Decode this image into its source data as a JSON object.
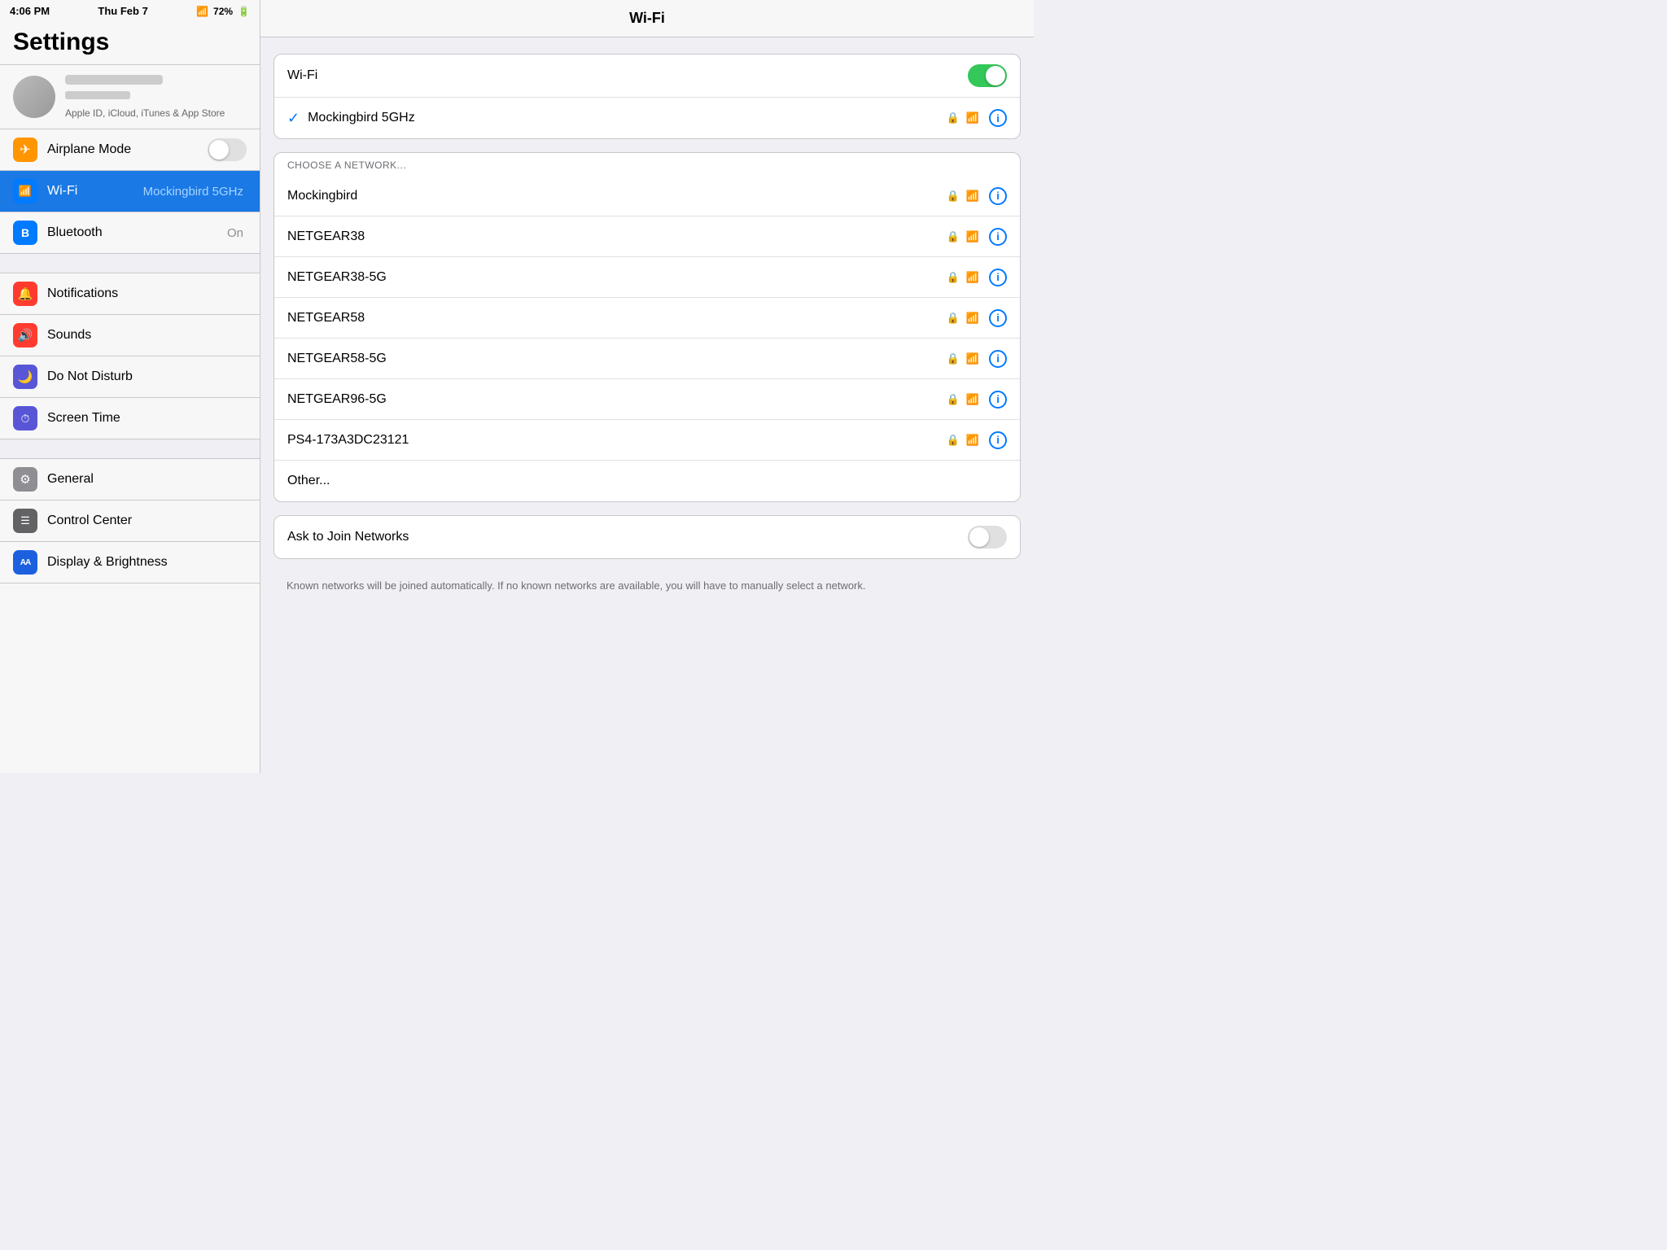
{
  "statusBar": {
    "time": "4:06 PM",
    "date": "Thu Feb 7",
    "battery": "72%"
  },
  "sidebar": {
    "title": "Settings",
    "profile": {
      "subtitle": "Apple ID, iCloud, iTunes & App Store"
    },
    "groups": [
      {
        "items": [
          {
            "id": "airplane-mode",
            "label": "Airplane Mode",
            "icon": "✈",
            "iconClass": "icon-orange",
            "hasToggle": true,
            "toggleOn": false
          },
          {
            "id": "wifi",
            "label": "Wi-Fi",
            "icon": "📶",
            "iconClass": "icon-blue",
            "value": "Mockingbird 5GHz",
            "selected": true
          },
          {
            "id": "bluetooth",
            "label": "Bluetooth",
            "icon": "B",
            "iconClass": "icon-blue-bt",
            "value": "On"
          }
        ]
      },
      {
        "items": [
          {
            "id": "notifications",
            "label": "Notifications",
            "icon": "🔔",
            "iconClass": "icon-red"
          },
          {
            "id": "sounds",
            "label": "Sounds",
            "icon": "🔊",
            "iconClass": "icon-red-sounds"
          },
          {
            "id": "do-not-disturb",
            "label": "Do Not Disturb",
            "icon": "🌙",
            "iconClass": "icon-purple"
          },
          {
            "id": "screen-time",
            "label": "Screen Time",
            "icon": "⏱",
            "iconClass": "icon-purple-screen"
          }
        ]
      },
      {
        "items": [
          {
            "id": "general",
            "label": "General",
            "icon": "⚙",
            "iconClass": "icon-gray"
          },
          {
            "id": "control-center",
            "label": "Control Center",
            "icon": "☰",
            "iconClass": "icon-dark-gray"
          },
          {
            "id": "display-brightness",
            "label": "Display & Brightness",
            "icon": "AA",
            "iconClass": "icon-aa"
          }
        ]
      }
    ]
  },
  "wifiPanel": {
    "title": "Wi-Fi",
    "wifiToggle": true,
    "wifiToggleLabel": "Wi-Fi",
    "connectedNetwork": "Mockingbird 5GHz",
    "sectionHeader": "CHOOSE A NETWORK...",
    "networks": [
      {
        "name": "Mockingbird",
        "locked": true,
        "hasInfo": true
      },
      {
        "name": "NETGEAR38",
        "locked": true,
        "hasInfo": true
      },
      {
        "name": "NETGEAR38-5G",
        "locked": true,
        "hasInfo": true
      },
      {
        "name": "NETGEAR58",
        "locked": true,
        "hasInfo": true
      },
      {
        "name": "NETGEAR58-5G",
        "locked": true,
        "hasInfo": true
      },
      {
        "name": "NETGEAR96-5G",
        "locked": true,
        "hasInfo": true
      },
      {
        "name": "PS4-173A3DC23121",
        "locked": true,
        "hasInfo": true
      },
      {
        "name": "Other...",
        "locked": false,
        "hasInfo": false
      }
    ],
    "askToJoinLabel": "Ask to Join Networks",
    "askToJoinToggle": false,
    "footerNote": "Known networks will be joined automatically. If no known networks are available, you will have to manually select a network."
  }
}
